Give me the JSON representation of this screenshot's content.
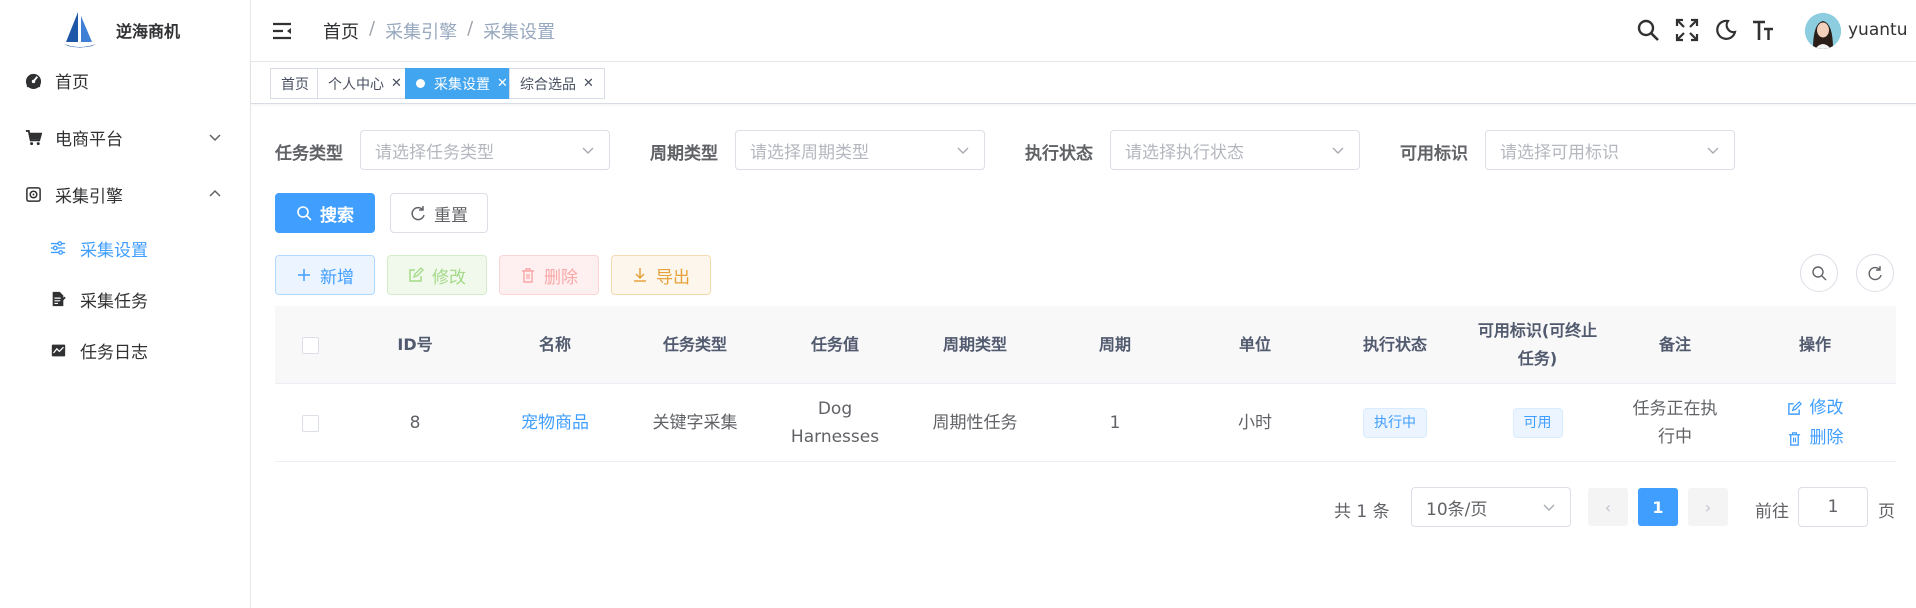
{
  "app": {
    "name": "逆海商机"
  },
  "sidebar": {
    "items": [
      {
        "label": "首页",
        "icon": "dashboard-icon"
      },
      {
        "label": "电商平台",
        "icon": "cart-icon",
        "expanded": false
      },
      {
        "label": "采集引擎",
        "icon": "engine-icon",
        "expanded": true
      },
      {
        "label": "采集设置",
        "icon": "settings-sliders-icon",
        "active": true
      },
      {
        "label": "采集任务",
        "icon": "task-doc-icon"
      },
      {
        "label": "任务日志",
        "icon": "log-chart-icon"
      }
    ]
  },
  "header": {
    "breadcrumb": [
      "首页",
      "采集引擎",
      "采集设置"
    ],
    "separator": "/",
    "username": "yuantu"
  },
  "tags": [
    {
      "label": "首页",
      "closable": false,
      "active": false
    },
    {
      "label": "个人中心",
      "closable": true,
      "active": false
    },
    {
      "label": "采集设置",
      "closable": true,
      "active": true
    },
    {
      "label": "综合选品",
      "closable": true,
      "active": false
    }
  ],
  "filters": [
    {
      "label": "任务类型",
      "placeholder": "请选择任务类型"
    },
    {
      "label": "周期类型",
      "placeholder": "请选择周期类型"
    },
    {
      "label": "执行状态",
      "placeholder": "请选择执行状态"
    },
    {
      "label": "可用标识",
      "placeholder": "请选择可用标识"
    }
  ],
  "buttons": {
    "search": "搜索",
    "reset": "重置",
    "add": "新增",
    "edit": "修改",
    "delete": "删除",
    "export": "导出"
  },
  "table": {
    "columns": [
      "ID号",
      "名称",
      "任务类型",
      "任务值",
      "周期类型",
      "周期",
      "单位",
      "执行状态",
      "可用标识(可终止任务)",
      "备注",
      "操作"
    ],
    "rows": [
      {
        "id": "8",
        "name": "宠物商品",
        "task_type": "关键字采集",
        "task_value": "Dog Harnesses",
        "cycle_type": "周期性任务",
        "cycle": "1",
        "unit": "小时",
        "status": "执行中",
        "available": "可用",
        "remark": "任务正在执行中",
        "ops": [
          "修改",
          "删除"
        ]
      }
    ]
  },
  "pagination": {
    "total_text": "共 1 条",
    "page_size": "10条/页",
    "current_page": "1",
    "goto_label": "前往",
    "goto_value": "1",
    "page_label": "页"
  },
  "colors": {
    "primary": "#409eff",
    "active_tag": "#42a5f0",
    "warning": "#e6a23c",
    "success_light": "#a4da89",
    "danger_light": "#f9a7a7"
  }
}
